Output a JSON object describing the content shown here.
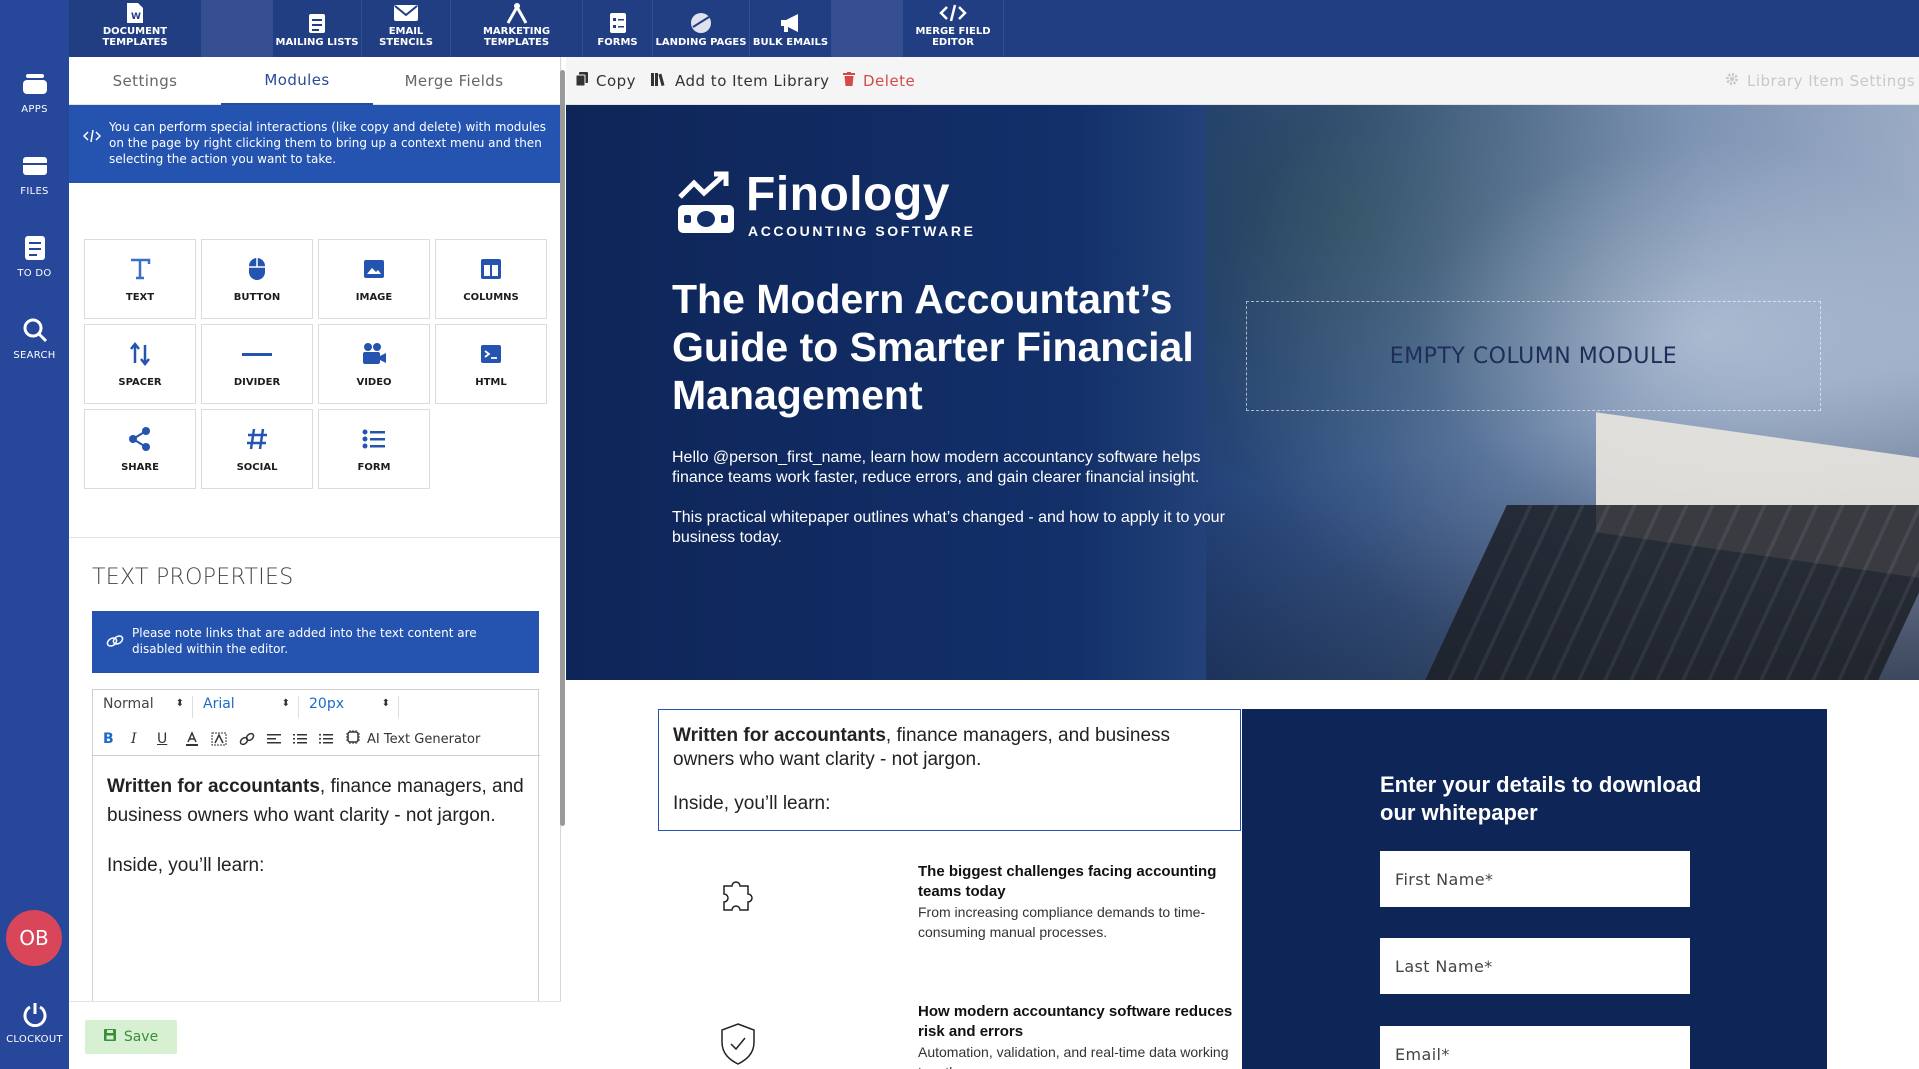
{
  "rail": {
    "items": [
      {
        "label": "APPS",
        "icon": "apps-icon"
      },
      {
        "label": "FILES",
        "icon": "files-icon"
      },
      {
        "label": "TO DO",
        "icon": "todo-icon"
      },
      {
        "label": "SEARCH",
        "icon": "search-icon"
      }
    ],
    "avatar": "OB",
    "clockout": "CLOCKOUT"
  },
  "topnav": {
    "items": [
      {
        "label": "DOCUMENT TEMPLATES",
        "icon": "document-icon"
      },
      {
        "label": "",
        "icon": ""
      },
      {
        "label": "MAILING LISTS",
        "icon": "list-icon"
      },
      {
        "label": "EMAIL STENCILS",
        "icon": "envelope-icon"
      },
      {
        "label": "MARKETING TEMPLATES",
        "icon": "compass-icon"
      },
      {
        "label": "FORMS",
        "icon": "form-icon"
      },
      {
        "label": "LANDING PAGES",
        "icon": "globe-icon"
      },
      {
        "label": "BULK EMAILS",
        "icon": "megaphone-icon"
      },
      {
        "label": "",
        "icon": ""
      },
      {
        "label": "MERGE FIELD EDITOR",
        "icon": "code-icon"
      }
    ]
  },
  "panel": {
    "tabs": [
      "Settings",
      "Modules",
      "Merge Fields"
    ],
    "active_tab": "Modules",
    "info": "You can perform special interactions (like copy and delete) with modules on the page by right clicking them to bring up a context menu and then selecting the action you want to take.",
    "modules": [
      "TEXT",
      "BUTTON",
      "IMAGE",
      "COLUMNS",
      "SPACER",
      "DIVIDER",
      "VIDEO",
      "HTML",
      "SHARE",
      "SOCIAL",
      "FORM"
    ],
    "text_properties_title": "TEXT PROPERTIES",
    "note": "Please note links that are added into the text content are disabled within the editor.",
    "editor": {
      "style": "Normal",
      "font": "Arial",
      "size": "20px",
      "ai_label": "AI Text Generator",
      "bold_lead": "Written for accountants",
      "para1_rest": ", finance managers, and business owners who want clarity - not jargon.",
      "para2": "Inside, you’ll learn:"
    },
    "save": "Save"
  },
  "toolbar": {
    "copy": "Copy",
    "add": "Add to Item Library",
    "delete": "Delete",
    "library_settings": "Library Item Settings"
  },
  "page": {
    "logo_name": "Finology",
    "logo_sub": "ACCOUNTING SOFTWARE",
    "hero_title": "The Modern Accountant’s Guide to Smarter Financial Management",
    "hero_p1": "Hello @person_first_name, learn how modern accountancy software helps finance teams work faster, reduce errors, and gain clearer financial insight.",
    "hero_p2": "This practical whitepaper outlines what’s changed - and how to apply it to your business today.",
    "empty_column": "EMPTY COLUMN MODULE",
    "intro_bold": "Written for accountants",
    "intro_rest": ", finance managers, and business owners who want clarity - not jargon.",
    "intro_2": "Inside, you’ll learn:",
    "features": [
      {
        "title": "The biggest challenges facing accounting teams today",
        "text": "From increasing compliance demands to time-consuming manual processes."
      },
      {
        "title": "How modern accountancy software reduces risk and errors",
        "text": "Automation, validation, and real-time data working together."
      }
    ],
    "form_title": "Enter your details to download our whitepaper",
    "fields": [
      "First Name*",
      "Last Name*",
      "Email*"
    ]
  }
}
